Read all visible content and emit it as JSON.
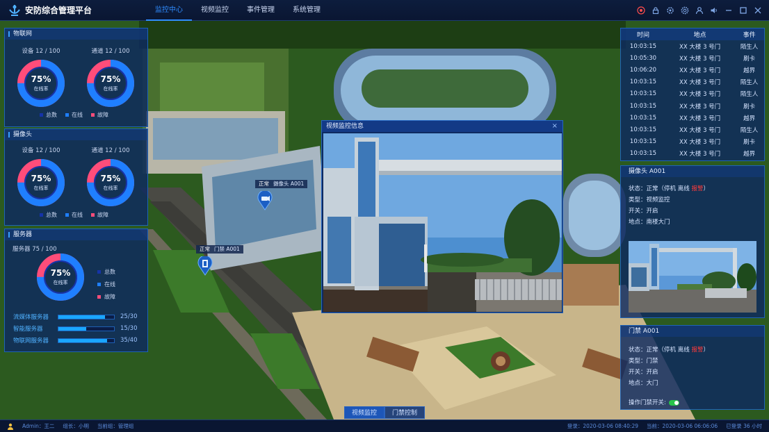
{
  "app": {
    "title": "安防综合管理平台"
  },
  "nav": [
    {
      "label": "监控中心",
      "active": true
    },
    {
      "label": "视频监控",
      "active": false
    },
    {
      "label": "事件管理",
      "active": false
    },
    {
      "label": "系统管理",
      "active": false
    }
  ],
  "top_icons": [
    "alert-icon",
    "lock-icon",
    "settings-wheel-icon",
    "gear-icon",
    "user-icon",
    "volume-icon",
    "minimize-icon",
    "maximize-icon",
    "close-icon"
  ],
  "iot": {
    "title": "物联网",
    "device_caption": "设备 12 / 100",
    "channel_caption": "通道 12 / 100",
    "device_rate": "75%",
    "channel_rate": "75%",
    "rate_label": "在线率",
    "online_fraction": 0.75,
    "legend": [
      "总数",
      "在线",
      "故障"
    ]
  },
  "camera": {
    "title": "摄像头",
    "device_caption": "设备 12 / 100",
    "channel_caption": "通道 12 / 100",
    "device_rate": "75%",
    "channel_rate": "75%",
    "rate_label": "在线率",
    "online_fraction": 0.75,
    "legend": [
      "总数",
      "在线",
      "故障"
    ]
  },
  "server": {
    "title": "服务器",
    "caption": "服务器 75 / 100",
    "rate": "75%",
    "rate_label": "在线率",
    "online_fraction": 0.75,
    "legend": [
      "总数",
      "在线",
      "故障"
    ],
    "bars": [
      {
        "label": "流媒体服务器",
        "value": "25/30",
        "fraction": 0.8333
      },
      {
        "label": "智能服务器",
        "value": "15/30",
        "fraction": 0.5
      },
      {
        "label": "物联网服务器",
        "value": "35/40",
        "fraction": 0.875
      }
    ]
  },
  "colors": {
    "total": "#1533a8",
    "online": "#1f7fff",
    "fault": "#ff4d7a",
    "accent": "#2f8cff"
  },
  "events": {
    "headers": [
      "时间",
      "地点",
      "事件"
    ],
    "rows": [
      [
        "10:03:15",
        "XX 大楼 3 号门",
        "陌生人"
      ],
      [
        "10:05:30",
        "XX 大楼 3 号门",
        "刷卡"
      ],
      [
        "10:06:20",
        "XX 大楼 3 号门",
        "越界"
      ],
      [
        "10:03:15",
        "XX 大楼 3 号门",
        "陌生人"
      ],
      [
        "10:03:15",
        "XX 大楼 3 号门",
        "陌生人"
      ],
      [
        "10:03:15",
        "XX 大楼 3 号门",
        "刷卡"
      ],
      [
        "10:03:15",
        "XX 大楼 3 号门",
        "越界"
      ],
      [
        "10:03:15",
        "XX 大楼 3 号门",
        "陌生人"
      ],
      [
        "10:03:15",
        "XX 大楼 3 号门",
        "刷卡"
      ],
      [
        "10:03:15",
        "XX 大楼 3 号门",
        "越界"
      ]
    ]
  },
  "camera_info": {
    "title": "摄像头 A001",
    "status_prefix": "状态：正常（停机",
    "status_offline": "离线",
    "status_alarm": "报警",
    "status_suffix": "）",
    "type": "类型：视频监控",
    "switch": "开关：开启",
    "location": "地点：南楼大门"
  },
  "door_info": {
    "title": "门禁 A001",
    "status_prefix": "状态：正常（停机",
    "status_offline": "离线",
    "status_alarm": "报警",
    "status_suffix": "）",
    "type": "类型：门禁",
    "switch": "开关：开启",
    "location": "地点：大门",
    "toggle_label": "操作门禁开关:",
    "toggle_on": true
  },
  "modal": {
    "title": "视频监控信息",
    "close": "×"
  },
  "markers": [
    {
      "status": "正常",
      "name": "摄像头 A001"
    },
    {
      "status": "正常",
      "name": "门禁 A001"
    }
  ],
  "bottom_tabs": [
    {
      "label": "视频监控",
      "active": true
    },
    {
      "label": "门禁控制",
      "active": false
    }
  ],
  "status": {
    "admin": "Admin：王二",
    "group_leader": "组长：小明",
    "current_group": "当前组：管理组",
    "login": "登录：2020-03-06 08:40:29",
    "now": "当前：2020-03-06 06:06:06",
    "elapsed": "已登录 36 小时"
  }
}
